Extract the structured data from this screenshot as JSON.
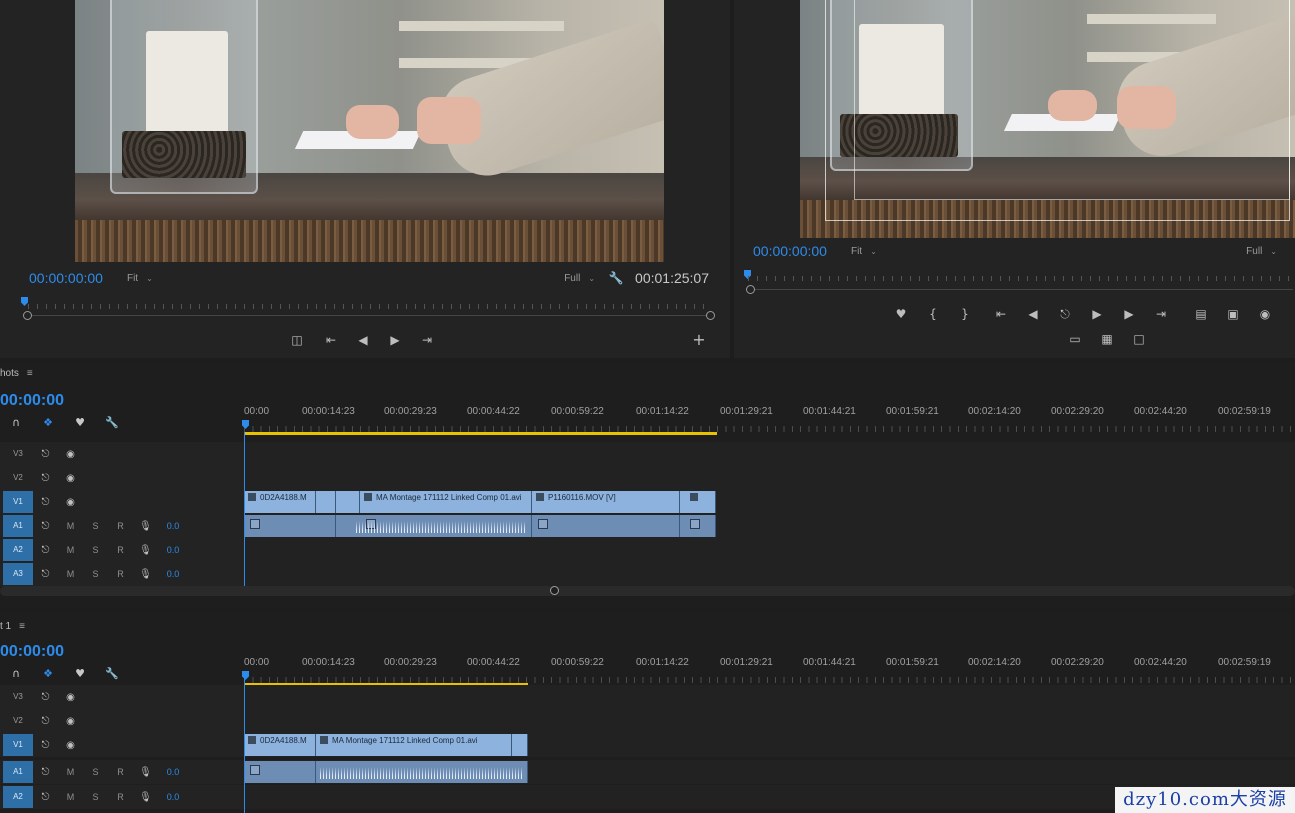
{
  "source_monitor": {
    "timecode": "00:00:00:00",
    "fit": "Fit",
    "quality": "Full",
    "duration": "00:01:25:07",
    "buttons": [
      "drag-video",
      "step-back-edit",
      "step-back",
      "step-forward",
      "step-forward-edit"
    ],
    "add_label": "+"
  },
  "program_monitor": {
    "timecode": "00:00:00:00",
    "fit": "Fit",
    "quality": "Full",
    "buttons_row1": [
      "marker",
      "mark-in",
      "mark-out",
      "go-to-in",
      "step-back",
      "lift",
      "play",
      "step-forward",
      "go-to-out",
      "lift-clip",
      "extract-clip",
      "export-frame"
    ],
    "buttons_row2": [
      "safe-margins",
      "comparison-view",
      "comment"
    ]
  },
  "timeline_top": {
    "tab": "hots",
    "timecode": "00:00:00",
    "ruler": [
      "00:00",
      "00:00:14:23",
      "00:00:29:23",
      "00:00:44:22",
      "00:00:59:22",
      "00:01:14:22",
      "00:01:29:21",
      "00:01:44:21",
      "00:01:59:21",
      "00:02:14:20",
      "00:02:29:20",
      "00:02:44:20",
      "00:02:59:19"
    ],
    "tracks": [
      {
        "name": "V3",
        "type": "video",
        "active": false
      },
      {
        "name": "V2",
        "type": "video",
        "active": false
      },
      {
        "name": "V1",
        "type": "video",
        "active": true
      },
      {
        "name": "A1",
        "type": "audio",
        "active": true,
        "value": "0.0"
      },
      {
        "name": "A2",
        "type": "audio",
        "active": true,
        "value": "0.0"
      },
      {
        "name": "A3",
        "type": "audio",
        "active": true,
        "value": "0.0"
      }
    ],
    "clips": {
      "c1": "0D2A4188.M",
      "c2": "MA Montage 171112 Linked Comp 01.avi",
      "c3": "P1160116.MOV [V]"
    }
  },
  "timeline_bottom": {
    "tab": "t 1",
    "timecode": "00:00:00",
    "ruler": [
      "00:00",
      "00:00:14:23",
      "00:00:29:23",
      "00:00:44:22",
      "00:00:59:22",
      "00:01:14:22",
      "00:01:29:21",
      "00:01:44:21",
      "00:01:59:21",
      "00:02:14:20",
      "00:02:29:20",
      "00:02:44:20",
      "00:02:59:19"
    ],
    "tracks": [
      {
        "name": "V3",
        "type": "video",
        "active": false
      },
      {
        "name": "V2",
        "type": "video",
        "active": false
      },
      {
        "name": "V1",
        "type": "video",
        "active": true
      },
      {
        "name": "A1",
        "type": "audio",
        "active": true,
        "value": "0.0"
      },
      {
        "name": "A2",
        "type": "audio",
        "active": true,
        "value": "0.0"
      }
    ],
    "clips": {
      "c1": "0D2A4188.M",
      "c2": "MA Montage 171112 Linked Comp 01.avi"
    }
  },
  "track_header_letters": {
    "m": "M",
    "s": "S",
    "r": "R"
  },
  "watermark": "dzy10.com大资源网",
  "colors": {
    "accent": "#2d8ceb",
    "video_clip": "#8cb2dd",
    "audio_clip": "#6d8db4",
    "work_area": "#e6c200"
  }
}
